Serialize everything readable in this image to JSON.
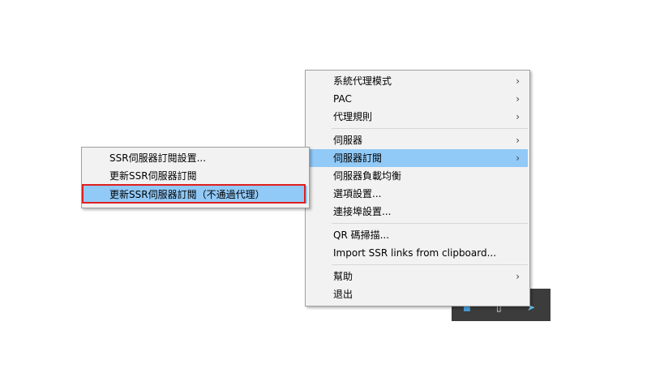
{
  "main_menu": {
    "items": [
      {
        "label": "系統代理模式",
        "arrow": "›"
      },
      {
        "label": "PAC",
        "arrow": "›"
      },
      {
        "label": "代理規則",
        "arrow": "›"
      },
      {
        "label": "伺服器",
        "arrow": "›"
      },
      {
        "label": "伺服器訂閱",
        "arrow": "›"
      },
      {
        "label": "伺服器負載均衡"
      },
      {
        "label": "選項設置..."
      },
      {
        "label": "連接埠設置..."
      },
      {
        "label": "QR 碼掃描..."
      },
      {
        "label": "Import SSR links from clipboard..."
      },
      {
        "label": "幫助",
        "arrow": "›"
      },
      {
        "label": "退出"
      }
    ],
    "highlighted": "伺服器訂閱"
  },
  "submenu": {
    "items": [
      {
        "label": "SSR伺服器訂閱設置..."
      },
      {
        "label": "更新SSR伺服器訂閱"
      },
      {
        "label": "更新SSR伺服器訂閱（不通過代理）"
      }
    ],
    "highlighted": "更新SSR伺服器訂閱（不通過代理）"
  },
  "tray": {
    "icons": [
      "tray-app-icon",
      "tray-window-icon",
      "tray-paper-plane-icon"
    ]
  },
  "colors": {
    "highlight": "#91c9f7",
    "annotation_box": "#e02020",
    "menu_bg": "#f2f2f2",
    "taskbar": "#3c3c3c"
  }
}
